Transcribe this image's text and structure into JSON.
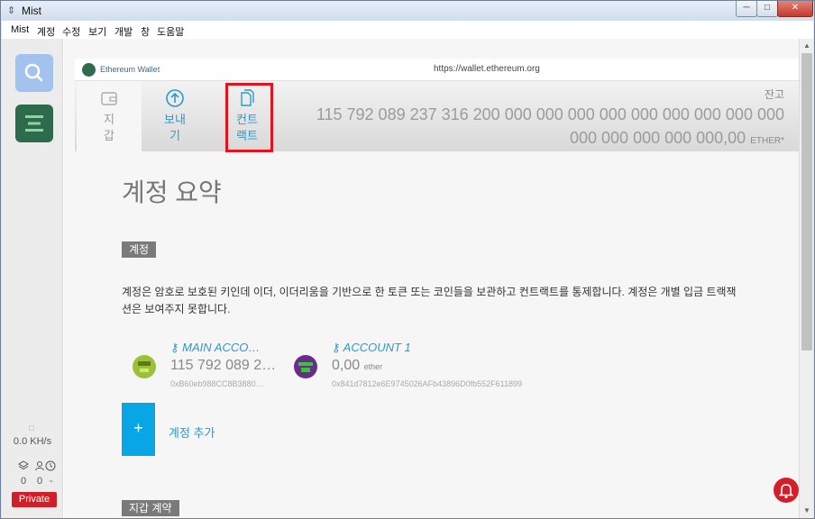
{
  "window": {
    "title": "Mist",
    "min_label": "─",
    "max_label": "□",
    "close_label": "✕"
  },
  "menu": [
    "Mist",
    "계정",
    "수정",
    "보기",
    "개발",
    "창",
    "도움말"
  ],
  "sidebar": {
    "hashrate": "0.0 KH/s",
    "peers": "0",
    "block": "0",
    "time": "-",
    "network": "Private"
  },
  "urlbar": {
    "site": "Ethereum Wallet",
    "url": "https://wallet.ethereum.org"
  },
  "tabs": {
    "wallet": "지\n갑",
    "send": "보내\n기",
    "contracts": "컨트\n랙트"
  },
  "balance": {
    "label": "잔고",
    "line1": "115 792 089 237 316 200 000 000 000 000 000 000 000 000 000",
    "line2": "000 000 000 000 000,00",
    "unit": "ETHER*"
  },
  "main": {
    "title": "계정 요약",
    "accounts_tag": "계정",
    "description": "계정은 암호로 보호된 키인데 이더, 이더리움을 기반으로 한 토큰 또는 코인들을 보관하고 컨트랙트를 통제합니다. 계정은 개별 입금 트랙잭션은 보여주지 못합니다.",
    "accounts": [
      {
        "name": "MAIN ACCO…",
        "amount": "115 792 089 2…",
        "unit": "",
        "address": "0xB60eb988CC8B3880…",
        "color": "#9bc13a"
      },
      {
        "name": "ACCOUNT 1",
        "amount": "0,00",
        "unit": "ether",
        "address": "0x841d7812e6E9745026AFb43896D0fb552F611899",
        "color": "#6a2c8a"
      }
    ],
    "add_button": "+",
    "add_label": "계정 추가",
    "contracts_tag": "지갑 계약"
  },
  "colors": {
    "accent": "#2a9ad0",
    "highlight": "#e0131f",
    "private": "#cf1f2a"
  }
}
